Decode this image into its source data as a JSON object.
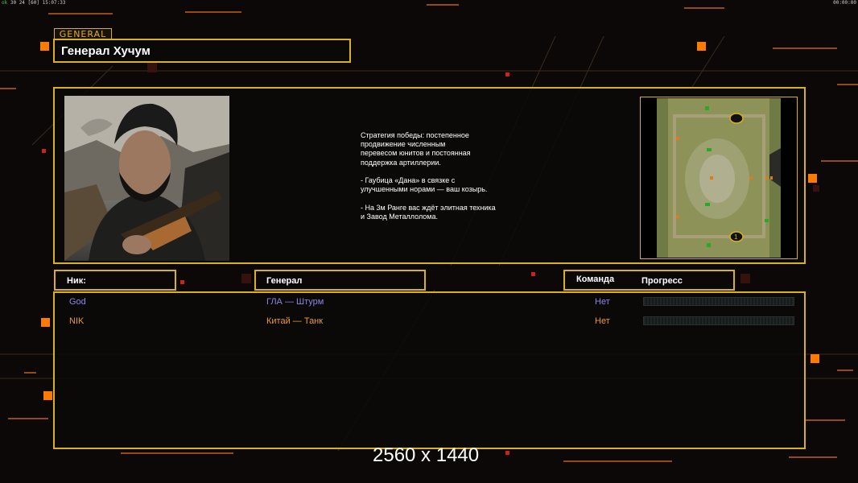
{
  "hud": {
    "top_left_green": "ok",
    "top_left_rest": "30 24 [60] 15:07:33",
    "top_right": "00:00:00"
  },
  "general_tab": "GENERAL",
  "title": "Генерал Хучум",
  "description": "Стратегия победы: постепенное\nпродвижение численным\nперевесом юнитов и постоянная\nподдержка артиллерии.\n\n- Гаубица «Дана» в связке с\nулучшенными норами — ваш козырь.\n\n- На 3м Ранге вас ждёт элитная техника\nи Завод Металлолома.",
  "minimap": {
    "start_labels": [
      "1"
    ]
  },
  "headers": {
    "nick": "Ник:",
    "general": "Генерал",
    "team": "Команда",
    "progress": "Прогресс"
  },
  "players": [
    {
      "name": "God",
      "general": "ГЛА — Штурм",
      "team": "Нет",
      "color": "#8a86e8"
    },
    {
      "name": "NIK",
      "general": "Китай — Танк",
      "team": "Нет",
      "color": "#e89a3a"
    }
  ],
  "resolution": "2560 x 1440",
  "colors": {
    "gold": "#d8b21e",
    "accent_orange": "#ff7a00",
    "background": "#0c0808"
  }
}
